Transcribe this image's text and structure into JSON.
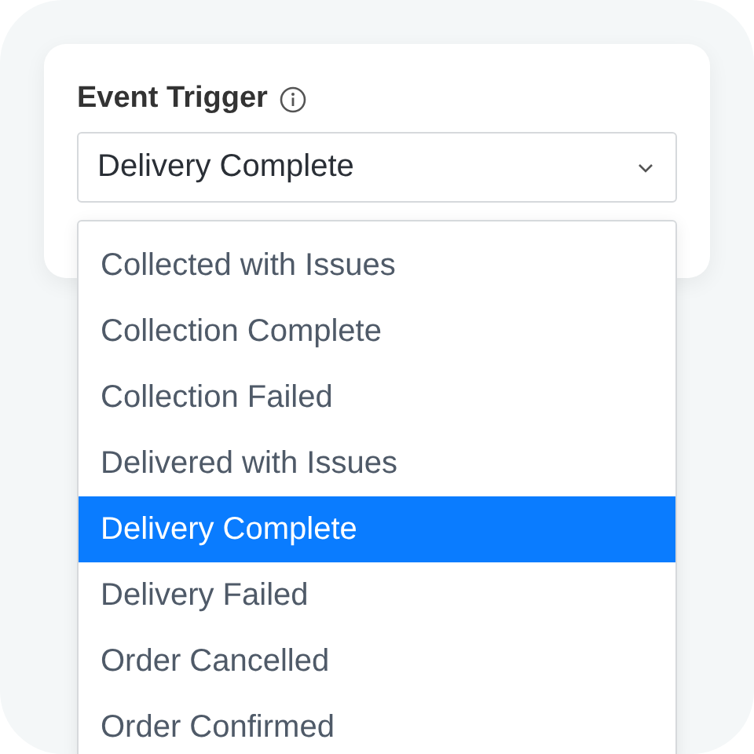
{
  "field": {
    "label": "Event Trigger",
    "value": "Delivery Complete"
  },
  "options": [
    {
      "label": "Collected with Issues",
      "selected": false
    },
    {
      "label": "Collection Complete",
      "selected": false
    },
    {
      "label": "Collection Failed",
      "selected": false
    },
    {
      "label": "Delivered with Issues",
      "selected": false
    },
    {
      "label": "Delivery Complete",
      "selected": true
    },
    {
      "label": "Delivery Failed",
      "selected": false
    },
    {
      "label": "Order Cancelled",
      "selected": false
    },
    {
      "label": "Order Confirmed",
      "selected": false
    }
  ]
}
